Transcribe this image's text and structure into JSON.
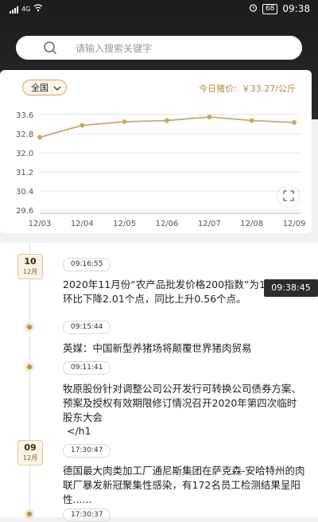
{
  "status_bar": {
    "network": "4G",
    "signal": "4G",
    "battery": "68",
    "time": "09:38"
  },
  "search": {
    "placeholder": "请输入搜索关键字"
  },
  "price_card": {
    "region": "全国",
    "price_label": "今日猪价:",
    "price_value": "￥33.27/公斤",
    "accent_color": "#c9a86a"
  },
  "chart_data": {
    "type": "line",
    "x": [
      "12/03",
      "12/04",
      "12/05",
      "12/06",
      "12/07",
      "12/08",
      "12/09"
    ],
    "series": [
      {
        "values": [
          32.65,
          33.15,
          33.3,
          33.35,
          33.5,
          33.35,
          33.27
        ]
      }
    ],
    "y_ticks": [
      "33.6",
      "32.8",
      "32.0",
      "31.2",
      "30.4",
      "29.6"
    ],
    "ylim": [
      29.6,
      33.6
    ],
    "grid": true,
    "color": "#c9a86a"
  },
  "feed": {
    "floating_time": "09:38:45",
    "groups": [
      {
        "day": "10",
        "month": "12月"
      },
      {
        "day": "09",
        "month": "12月"
      }
    ],
    "items": [
      {
        "time": "09:16:55",
        "text": "2020年11月份“农产品批发价格200指数”为117.37，环比下降2.01个点，同比上升0.56个点。"
      },
      {
        "time": "09:15:44",
        "text": "英媒：中国新型养猪场将颠覆世界猪肉贸易"
      },
      {
        "time": "09:11:41",
        "text": "牧原股份针对调整公司公开发行可转换公司债券方案、预案及授权有效期限修订情况召开2020年第四次临时股东大会"
      },
      {
        "extra": "</h1"
      },
      {
        "time": "17:30:47",
        "text": "德国最大肉类加工厂通尼斯集团在萨克森-安哈特州的肉联厂暴发新冠聚集性感染，有172名员工检测结果呈阳性......"
      },
      {
        "time": "17:30:37"
      }
    ]
  }
}
